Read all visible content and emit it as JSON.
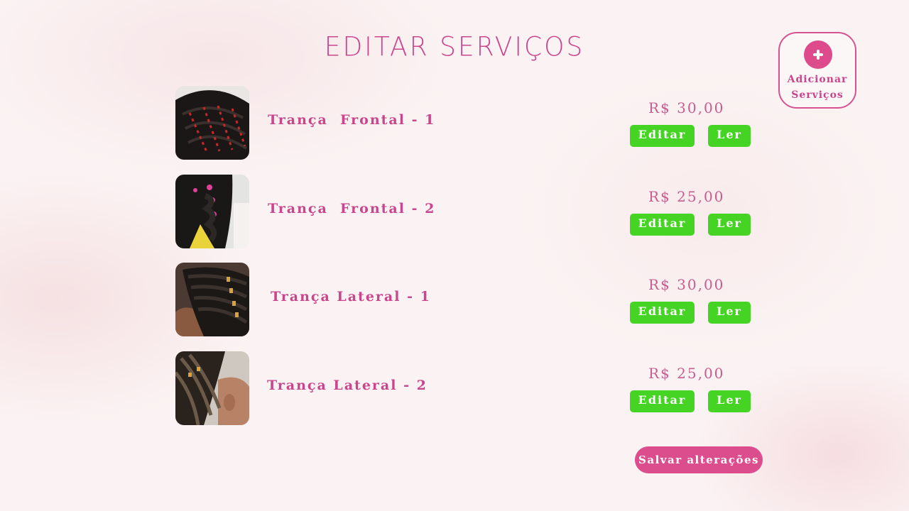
{
  "page": {
    "title": "EDITAR  SERVIÇOS",
    "add_button_label_line1": "Adicionar",
    "add_button_label_line2": "Serviços",
    "save_button_label": "Salvar alterações"
  },
  "services": [
    {
      "name": "Trança  Frontal - 1",
      "price": "R$ 30,00",
      "edit_label": "Editar",
      "read_label": "Ler"
    },
    {
      "name": "Trança  Frontal - 2",
      "price": "R$ 25,00",
      "edit_label": "Editar",
      "read_label": "Ler"
    },
    {
      "name": "Trança Lateral - 1",
      "price": "R$ 30,00",
      "edit_label": "Editar",
      "read_label": "Ler"
    },
    {
      "name": "Trança Lateral - 2",
      "price": "R$ 25,00",
      "edit_label": "Editar",
      "read_label": "Ler"
    }
  ],
  "colors": {
    "accent_pink": "#c9458c",
    "button_pink": "#dc4d8d",
    "button_green": "#45d423",
    "background": "#fbf3f3"
  }
}
